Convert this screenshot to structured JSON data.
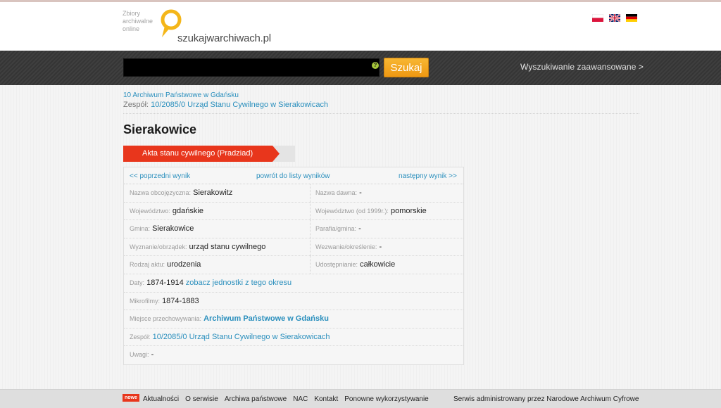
{
  "header": {
    "logo_small": "Zbiory archiwalne online",
    "logo_text": "szukajwarchiwach.pl",
    "flags": [
      "flag-pl-icon",
      "flag-gb-icon",
      "flag-de-icon"
    ]
  },
  "search": {
    "value": "",
    "help_icon": "?",
    "button_label": "Szukaj",
    "advanced_link": "Wyszukiwanie zaawansowane >"
  },
  "breadcrumb": {
    "archive": "10 Archiwum Państwowe w Gdańsku",
    "zespol_label": "Zespół:",
    "zespol_link": "10/2085/0 Urząd Stanu Cywilnego w Sierakowicach"
  },
  "page_title": "Sierakowice",
  "tab_label": "Akta stanu cywilnego (Pradziad)",
  "nav": {
    "prev": "<< poprzedni wynik",
    "back": "powrót do listy wyników",
    "next": "następny wynik >>"
  },
  "fields": {
    "nazwa_obca_label": "Nazwa obcojęzyczna:",
    "nazwa_obca_value": "Sierakowitz",
    "nazwa_dawna_label": "Nazwa dawna:",
    "nazwa_dawna_value": "-",
    "wojewodztwo_label": "Województwo:",
    "wojewodztwo_value": "gdańskie",
    "wojewodztwo_1999_label": "Województwo (od 1999r.):",
    "wojewodztwo_1999_value": "pomorskie",
    "gmina_label": "Gmina:",
    "gmina_value": "Sierakowice",
    "parafia_label": "Parafia/gmina:",
    "parafia_value": "-",
    "wyznanie_label": "Wyznanie/obrządek:",
    "wyznanie_value": "urząd stanu cywilnego",
    "wezwanie_label": "Wezwanie/określenie:",
    "wezwanie_value": "-",
    "rodzaj_label": "Rodzaj aktu:",
    "rodzaj_value": "urodzenia",
    "udostepnianie_label": "Udostępnianie:",
    "udostepnianie_value": "całkowicie",
    "daty_label": "Daty:",
    "daty_value": "1874-1914",
    "daty_link": "zobacz jednostki z tego okresu",
    "mikrofilmy_label": "Mikrofilmy:",
    "mikrofilmy_value": "1874-1883",
    "miejsce_label": "Miejsce przechowywania:",
    "miejsce_value": "Archiwum Państwowe w Gdańsku",
    "zespol_label": "Zespół:",
    "zespol_value": "10/2085/0 Urząd Stanu Cywilnego w Sierakowicach",
    "uwagi_label": "Uwagi:",
    "uwagi_value": "-"
  },
  "footer": {
    "badge": "nowe",
    "links": [
      "Aktualności",
      "O serwisie",
      "Archiwa państwowe",
      "NAC",
      "Kontakt",
      "Ponowne wykorzystywanie"
    ],
    "admin_text": "Serwis administrowany przez Narodowe Archiwum Cyfrowe"
  },
  "colors": {
    "accent_red": "#e8361c",
    "link_blue": "#2a8fbd",
    "search_button_orange": "#f0a020",
    "searchbar_dark": "#3a3a3a"
  }
}
